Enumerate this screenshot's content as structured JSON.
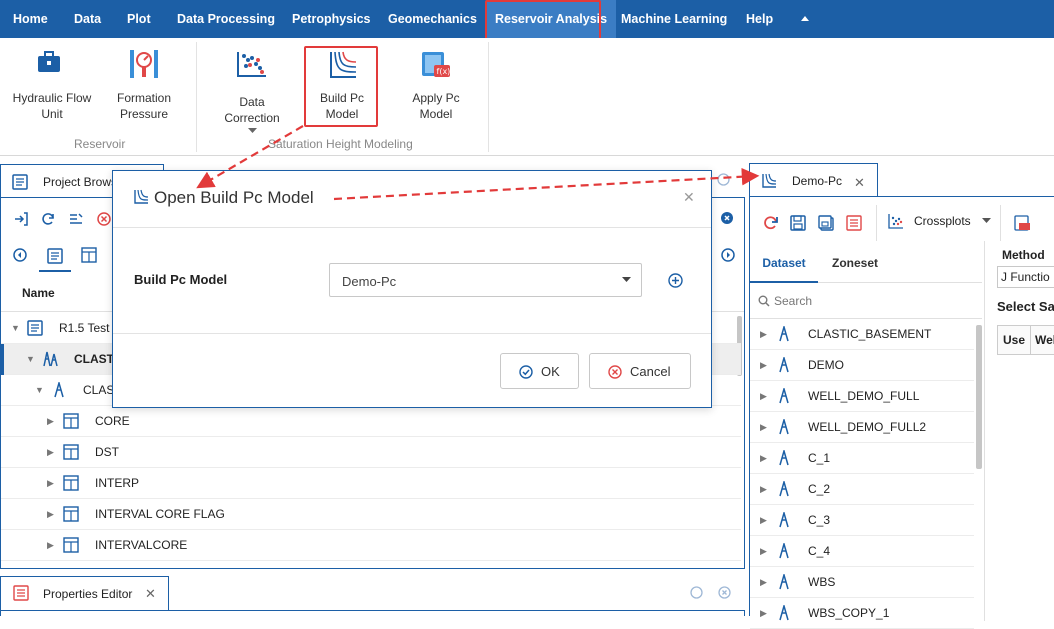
{
  "menu": {
    "items": [
      "Home",
      "Data",
      "Plot",
      "Data Processing",
      "Petrophysics",
      "Geomechanics",
      "Reservoir Analysis",
      "Machine Learning",
      "Help"
    ],
    "active": "Reservoir Analysis"
  },
  "ribbon": {
    "hydraulic_flow_unit": "Hydraulic Flow Unit",
    "formation_pressure": "Formation Pressure",
    "group_reservoir": "Reservoir",
    "data_correction": "Data Correction",
    "build_pc_model": "Build Pc Model",
    "apply_pc_model": "Apply Pc Model",
    "group_saturation": "Saturation Height Modeling"
  },
  "project_browser": {
    "tab_label": "Project Brows",
    "column_name": "Name",
    "root": "R1.5 Test",
    "well_group": "CLASTI",
    "well": "CLAST",
    "datasets": [
      "CORE",
      "DST",
      "INTERP",
      "INTERVAL CORE FLAG",
      "INTERVALCORE"
    ]
  },
  "properties_editor": {
    "tab_label": "Properties Editor"
  },
  "dialog": {
    "title": "Open Build Pc Model",
    "field_label": "Build Pc Model",
    "selected": "Demo-Pc",
    "ok": "OK",
    "cancel": "Cancel"
  },
  "demo_panel": {
    "tab_label": "Demo-Pc",
    "crossplots": "Crossplots",
    "tabs": [
      "Dataset",
      "Zoneset"
    ],
    "search_placeholder": "Search",
    "wells": [
      "CLASTIC_BASEMENT",
      "DEMO",
      "WELL_DEMO_FULL",
      "WELL_DEMO_FULL2",
      "C_1",
      "C_2",
      "C_3",
      "C_4",
      "WBS",
      "WBS_COPY_1"
    ],
    "method_label": "Method",
    "method_value": "J Functio",
    "select_sample": "Select Sar",
    "col_use": "Use",
    "col_well": "Wel"
  },
  "colors": {
    "brand": "#1c5fa6",
    "highlight": "#e23a3a"
  }
}
